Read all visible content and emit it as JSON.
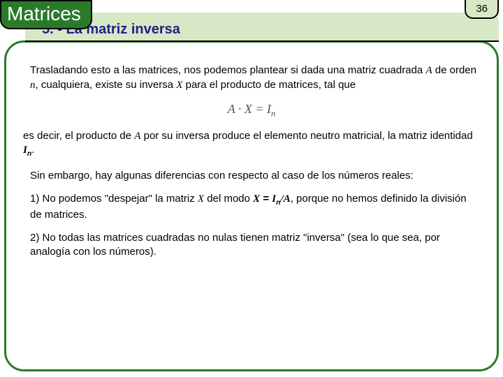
{
  "header": {
    "title": "Matrices",
    "page_number": "36",
    "subtitle": "5. - La matriz inversa"
  },
  "body": {
    "p1_a": "Trasladando esto a las matrices, nos podemos plantear si dada una matriz cuadrada ",
    "p1_A": "A",
    "p1_b": " de orden ",
    "p1_n": "n",
    "p1_c": ", cualquiera, existe su inversa ",
    "p1_X": "X",
    "p1_d": " para el producto de matrices, tal que",
    "equation": "A · X = I",
    "eq_sub": "n",
    "p2_a": "es decir, el producto de ",
    "p2_A": "A",
    "p2_b": " por su inversa produce el elemento neutro matricial, la matriz identidad ",
    "p2_I": "I",
    "p2_n": "n",
    "p2_c": ".",
    "p3": "Sin embargo, hay algunas diferencias con respecto al caso de los números reales:",
    "p4_a": "1) No podemos \"despejar\" la matriz ",
    "p4_X1": "X",
    "p4_b": " del modo ",
    "p4_X2": "X",
    "p4_c": " = ",
    "p4_I": "I",
    "p4_n": "n",
    "p4_d": "/",
    "p4_A": "A",
    "p4_e": ", porque no hemos definido la división de matrices.",
    "p5": "2) No todas las matrices cuadradas no nulas tienen matriz \"inversa\" (sea lo que sea, por analogía con los números)."
  }
}
